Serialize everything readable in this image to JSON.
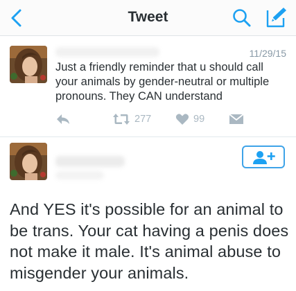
{
  "nav": {
    "title": "Tweet",
    "back_icon": "chevron-left-icon",
    "search_icon": "search-icon",
    "compose_icon": "compose-icon"
  },
  "colors": {
    "accent": "#1da1f2",
    "muted": "#aab8c2",
    "text": "#292f33"
  },
  "previous_tweet": {
    "date": "11/29/15",
    "text": "Just a friendly reminder that u should call your animals by gender-neutral or multiple pronouns. They CAN understand",
    "actions": {
      "reply_icon": "reply-icon",
      "retweet_icon": "retweet-icon",
      "retweet_count": "277",
      "like_icon": "heart-icon",
      "like_count": "99",
      "dm_icon": "envelope-icon"
    }
  },
  "main_tweet": {
    "follow_icon": "add-user-icon",
    "text": "And YES it's possible for an animal to be trans. Your cat having a penis does not make it male. It's animal abuse to misgender your animals."
  }
}
